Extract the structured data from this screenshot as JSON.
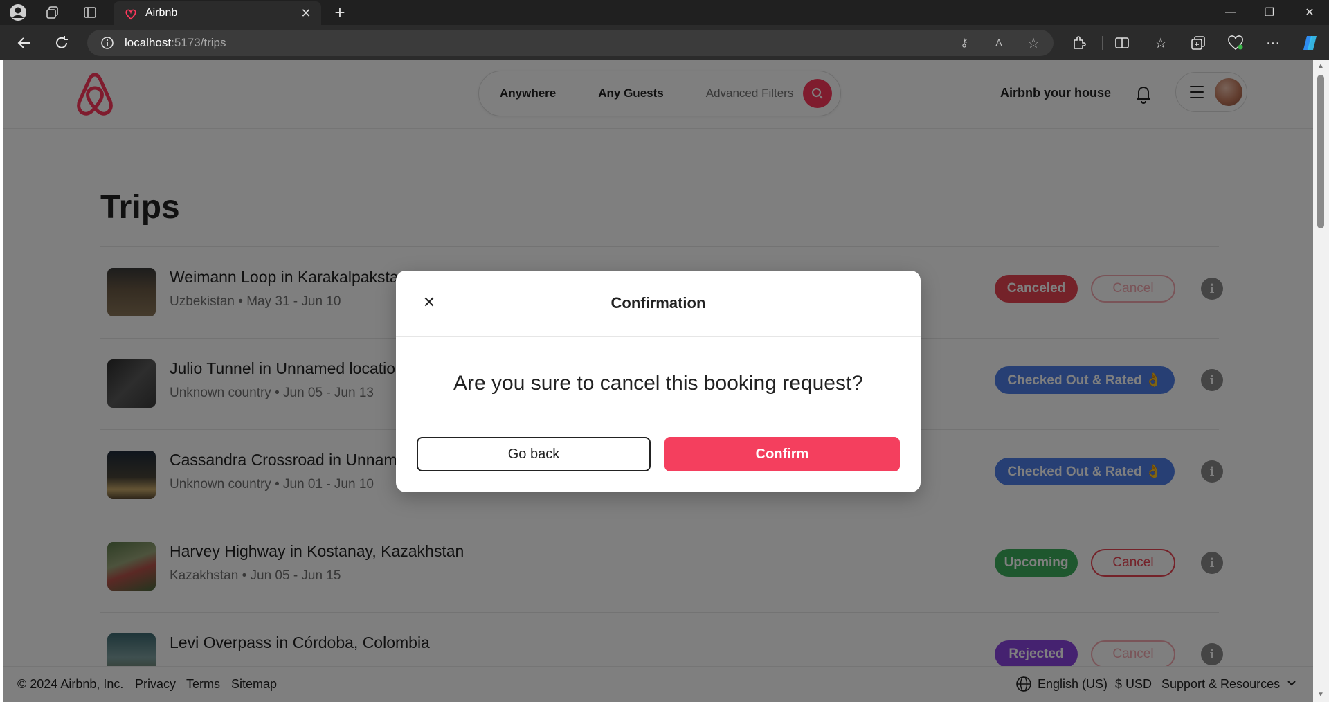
{
  "browser": {
    "tab_title": "Airbnb",
    "url_host": "localhost",
    "url_path": ":5173/trips"
  },
  "header": {
    "search": {
      "where": "Anywhere",
      "guests": "Any Guests",
      "filters": "Advanced Filters"
    },
    "host_link": "Airbnb your house"
  },
  "page": {
    "title": "Trips",
    "trips": [
      {
        "name": "Weimann Loop in Karakalpaksta",
        "meta": "Uzbekistan • May 31 - Jun 10",
        "status": "Canceled",
        "cancel_label": "Cancel"
      },
      {
        "name": "Julio Tunnel in Unnamed locatio",
        "meta": "Unknown country • Jun 05 - Jun 13",
        "status": "Checked Out & Rated 👌"
      },
      {
        "name": "Cassandra Crossroad in Unname",
        "meta": "Unknown country • Jun 01 - Jun 10",
        "status": "Checked Out & Rated 👌"
      },
      {
        "name": "Harvey Highway in Kostanay, Kazakhstan",
        "meta": "Kazakhstan • Jun 05 - Jun 15",
        "status": "Upcoming",
        "cancel_label": "Cancel"
      },
      {
        "name": "Levi Overpass in Córdoba, Colombia",
        "meta": "",
        "status": "Rejected",
        "cancel_label": "Cancel"
      }
    ]
  },
  "footer": {
    "copyright": "© 2024 Airbnb, Inc.",
    "links": [
      "Privacy",
      "Terms",
      "Sitemap"
    ],
    "language": "English (US)",
    "currency": "$ USD",
    "support": "Support & Resources"
  },
  "modal": {
    "title": "Confirmation",
    "question": "Are you sure to cancel this booking request?",
    "back_label": "Go back",
    "confirm_label": "Confirm"
  },
  "colors": {
    "brand": "#ff385c",
    "confirm": "#f43f5e",
    "canceled": "#e94453",
    "rated": "#4f7fe8",
    "upcoming": "#3dae5c",
    "rejected": "#8a44e0"
  }
}
